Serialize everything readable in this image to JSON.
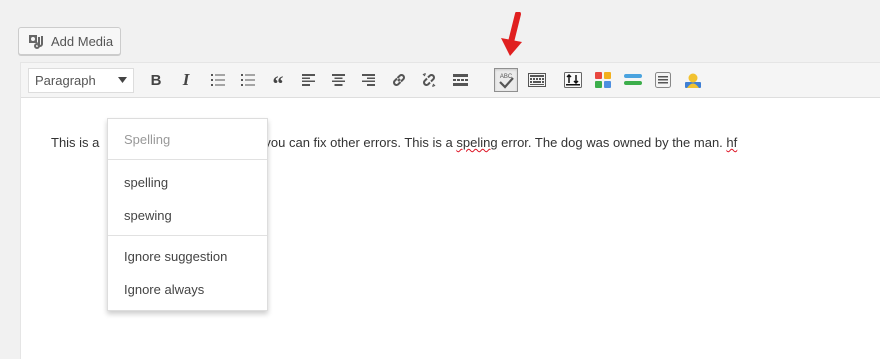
{
  "add_media": {
    "label": "Add Media",
    "icon": "media-icon"
  },
  "toolbar": {
    "format_select": "Paragraph",
    "bold": "B",
    "italic": "I",
    "quote": "“",
    "spellcheck_label": "ABC"
  },
  "content": {
    "text_before": "This is a",
    "text_middle": "you can fix other errors. This is a ",
    "misspelled_1": "speling",
    "text_after": " error. The dog was owned by the man. ",
    "misspelled_2": "hf"
  },
  "menu": {
    "header": "Spelling",
    "suggestions": [
      "spelling",
      "spewing"
    ],
    "actions": [
      "Ignore suggestion",
      "Ignore always"
    ]
  },
  "colors": {
    "annotation_arrow": "#e02020",
    "misspelled_underline": "#dd1122"
  }
}
